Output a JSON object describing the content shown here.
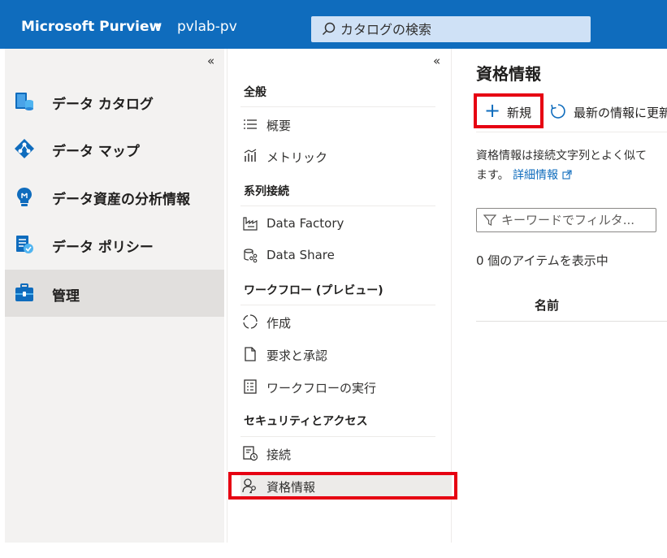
{
  "header": {
    "brand": "Microsoft Purview",
    "breadcrumb_chevron": "▸",
    "account": "pvlab-pv",
    "search_placeholder": "カタログの検索"
  },
  "left_nav": {
    "collapse_label": "«",
    "items": [
      {
        "label": "データ カタログ",
        "icon": "data-catalog-icon"
      },
      {
        "label": "データ マップ",
        "icon": "data-map-icon"
      },
      {
        "label": "データ資産の分析情報",
        "icon": "insights-lightbulb-icon"
      },
      {
        "label": "データ ポリシー",
        "icon": "data-policy-icon"
      },
      {
        "label": "管理",
        "icon": "management-toolbox-icon",
        "active": true
      }
    ]
  },
  "mid_nav": {
    "collapse_label": "«",
    "sections": [
      {
        "title": "全般",
        "items": [
          {
            "label": "概要",
            "icon": "list-icon"
          },
          {
            "label": "メトリック",
            "icon": "metrics-icon"
          }
        ]
      },
      {
        "title": "系列接続",
        "items": [
          {
            "label": "Data Factory",
            "icon": "data-factory-icon"
          },
          {
            "label": "Data Share",
            "icon": "data-share-icon"
          }
        ]
      },
      {
        "title": "ワークフロー (プレビュー)",
        "items": [
          {
            "label": "作成",
            "icon": "workflow-authoring-icon"
          },
          {
            "label": "要求と承認",
            "icon": "document-icon"
          },
          {
            "label": "ワークフローの実行",
            "icon": "checklist-icon"
          }
        ]
      },
      {
        "title": "セキュリティとアクセス",
        "items": [
          {
            "label": "接続",
            "icon": "connection-icon"
          },
          {
            "label": "資格情報",
            "icon": "credentials-icon",
            "selected": true
          }
        ]
      }
    ]
  },
  "content": {
    "title": "資格情報",
    "toolbar": {
      "new_label": "新規",
      "refresh_label": "最新の情報に更新"
    },
    "description_line1": "資格情報は接続文字列とよく似て",
    "description_line2": "ます。",
    "details_link": "詳細情報",
    "filter_placeholder": "キーワードでフィルタ...",
    "item_count": "0 個のアイテムを表示中",
    "table_columns": [
      "名前"
    ]
  },
  "colors": {
    "header_bg": "#0f6cbd",
    "search_bg": "#cfe1f6",
    "highlight_red": "#e60012",
    "left_nav_bg": "#f3f2f1"
  }
}
